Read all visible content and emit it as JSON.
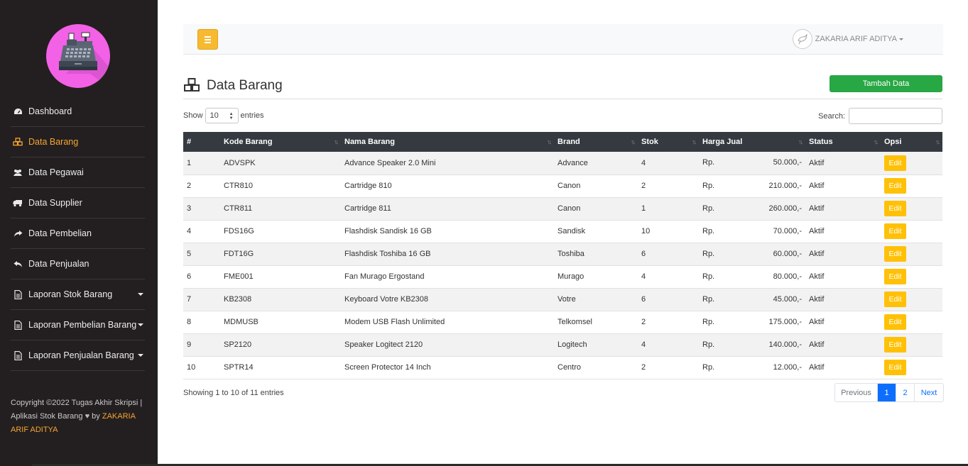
{
  "sidebar": {
    "items": [
      {
        "label": "Dashboard",
        "icon": "dashboard-icon"
      },
      {
        "label": "Data Barang",
        "icon": "cubes-icon",
        "active": true
      },
      {
        "label": "Data Pegawai",
        "icon": "users-icon"
      },
      {
        "label": "Data Supplier",
        "icon": "truck-icon"
      },
      {
        "label": "Data Pembelian",
        "icon": "share-icon"
      },
      {
        "label": "Data Penjualan",
        "icon": "reply-icon"
      },
      {
        "label": "Laporan Stok Barang",
        "icon": "file-icon",
        "dropdown": true
      },
      {
        "label": "Laporan Pembelian Barang",
        "icon": "file-icon",
        "dropdown": true
      },
      {
        "label": "Laporan Penjualan Barang",
        "icon": "file-icon",
        "dropdown": true
      }
    ],
    "copyright_prefix": "Copyright ©2022 Tugas Akhir Skripsi | Aplikasi Stok Barang",
    "copyright_by": "by",
    "copyright_author": "ZAKARIA ARIF ADITYA"
  },
  "topbar": {
    "user_name": "ZAKARIA ARIF ADITYA"
  },
  "page": {
    "title": "Data Barang",
    "add_button": "Tambah Data",
    "show_label": "Show",
    "show_value": "10",
    "entries_label": "entries",
    "search_label": "Search:",
    "info": "Showing 1 to 10 of 11 entries"
  },
  "table": {
    "headers": [
      "#",
      "Kode Barang",
      "Nama Barang",
      "Brand",
      "Stok",
      "Harga Jual",
      "Status",
      "Opsi"
    ],
    "rows": [
      {
        "no": "1",
        "kode": "ADVSPK",
        "nama": "Advance Speaker 2.0 Mini",
        "brand": "Advance",
        "stok": "4",
        "cur": "Rp.",
        "harga": "50.000,-",
        "status": "Aktif",
        "opsi": "Edit"
      },
      {
        "no": "2",
        "kode": "CTR810",
        "nama": "Cartridge 810",
        "brand": "Canon",
        "stok": "2",
        "cur": "Rp.",
        "harga": "210.000,-",
        "status": "Aktif",
        "opsi": "Edit"
      },
      {
        "no": "3",
        "kode": "CTR811",
        "nama": "Cartridge 811",
        "brand": "Canon",
        "stok": "1",
        "cur": "Rp.",
        "harga": "260.000,-",
        "status": "Aktif",
        "opsi": "Edit"
      },
      {
        "no": "4",
        "kode": "FDS16G",
        "nama": "Flashdisk Sandisk 16 GB",
        "brand": "Sandisk",
        "stok": "10",
        "cur": "Rp.",
        "harga": "70.000,-",
        "status": "Aktif",
        "opsi": "Edit"
      },
      {
        "no": "5",
        "kode": "FDT16G",
        "nama": "Flashdisk Toshiba 16 GB",
        "brand": "Toshiba",
        "stok": "6",
        "cur": "Rp.",
        "harga": "60.000,-",
        "status": "Aktif",
        "opsi": "Edit"
      },
      {
        "no": "6",
        "kode": "FME001",
        "nama": "Fan Murago Ergostand",
        "brand": "Murago",
        "stok": "4",
        "cur": "Rp.",
        "harga": "80.000,-",
        "status": "Aktif",
        "opsi": "Edit"
      },
      {
        "no": "7",
        "kode": "KB2308",
        "nama": "Keyboard Votre KB2308",
        "brand": "Votre",
        "stok": "6",
        "cur": "Rp.",
        "harga": "45.000,-",
        "status": "Aktif",
        "opsi": "Edit"
      },
      {
        "no": "8",
        "kode": "MDMUSB",
        "nama": "Modem USB Flash Unlimited",
        "brand": "Telkomsel",
        "stok": "2",
        "cur": "Rp.",
        "harga": "175.000,-",
        "status": "Aktif",
        "opsi": "Edit"
      },
      {
        "no": "9",
        "kode": "SP2120",
        "nama": "Speaker Logitect 2120",
        "brand": "Logitech",
        "stok": "4",
        "cur": "Rp.",
        "harga": "140.000,-",
        "status": "Aktif",
        "opsi": "Edit"
      },
      {
        "no": "10",
        "kode": "SPTR14",
        "nama": "Screen Protector 14 Inch",
        "brand": "Centro",
        "stok": "2",
        "cur": "Rp.",
        "harga": "12.000,-",
        "status": "Aktif",
        "opsi": "Edit"
      }
    ]
  },
  "pagination": {
    "previous": "Previous",
    "pages": [
      "1",
      "2"
    ],
    "next": "Next"
  },
  "colors": {
    "sidebar_bg": "#231f20",
    "active_accent": "#f7a531",
    "logo_bg": "#f261e6",
    "add_button": "#28a745",
    "edit_button": "#ffc107",
    "table_header": "#343a40",
    "page_active": "#0d6efd"
  }
}
